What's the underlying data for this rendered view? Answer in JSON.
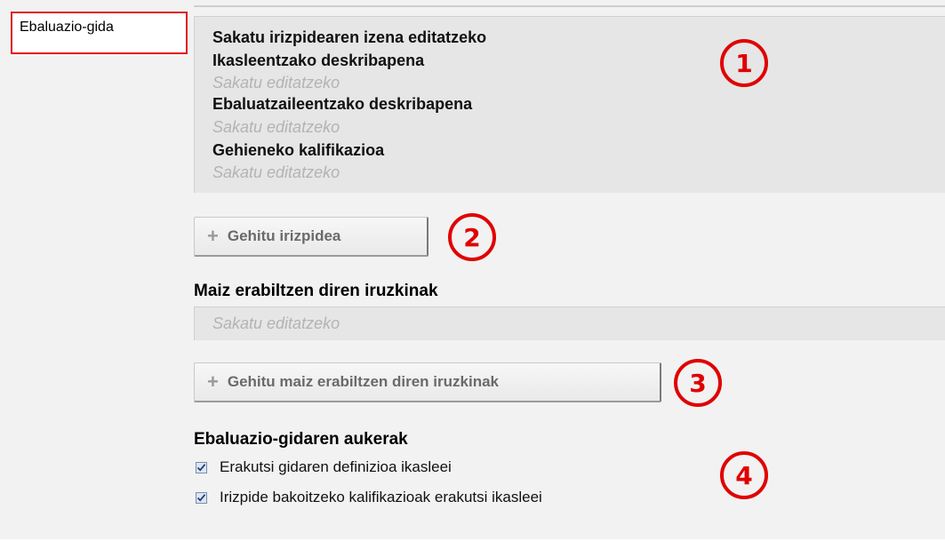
{
  "rubric_label": "Ebaluazio-gida",
  "criterion": {
    "name_prompt": "Sakatu irizpidearen izena editatzeko",
    "student_desc_label": "Ikasleentzako deskribapena",
    "student_desc_placeholder": "Sakatu editatzeko",
    "evaluator_desc_label": "Ebaluatzaileentzako deskribapena",
    "evaluator_desc_placeholder": "Sakatu editatzeko",
    "max_grade_label": "Gehieneko kalifikazioa",
    "max_grade_placeholder": "Sakatu editatzeko"
  },
  "buttons": {
    "add_criterion": "Gehitu irizpidea",
    "add_frequent_comments": "Gehitu maiz erabiltzen diren iruzkinak",
    "plus_glyph": "+"
  },
  "frequent_comments": {
    "title": "Maiz erabiltzen diren iruzkinak",
    "placeholder": "Sakatu editatzeko"
  },
  "options": {
    "title": "Ebaluazio-gidaren aukerak",
    "items": [
      {
        "label": "Erakutsi gidaren definizioa ikasleei",
        "checked": true
      },
      {
        "label": "Irizpide bakoitzeko kalifikazioak erakutsi ikasleei",
        "checked": true
      }
    ]
  },
  "markers": [
    "1",
    "2",
    "3",
    "4"
  ],
  "colors": {
    "annotation": "#e00000",
    "panel": "#e6e6e6",
    "background": "#f2f2f2"
  }
}
